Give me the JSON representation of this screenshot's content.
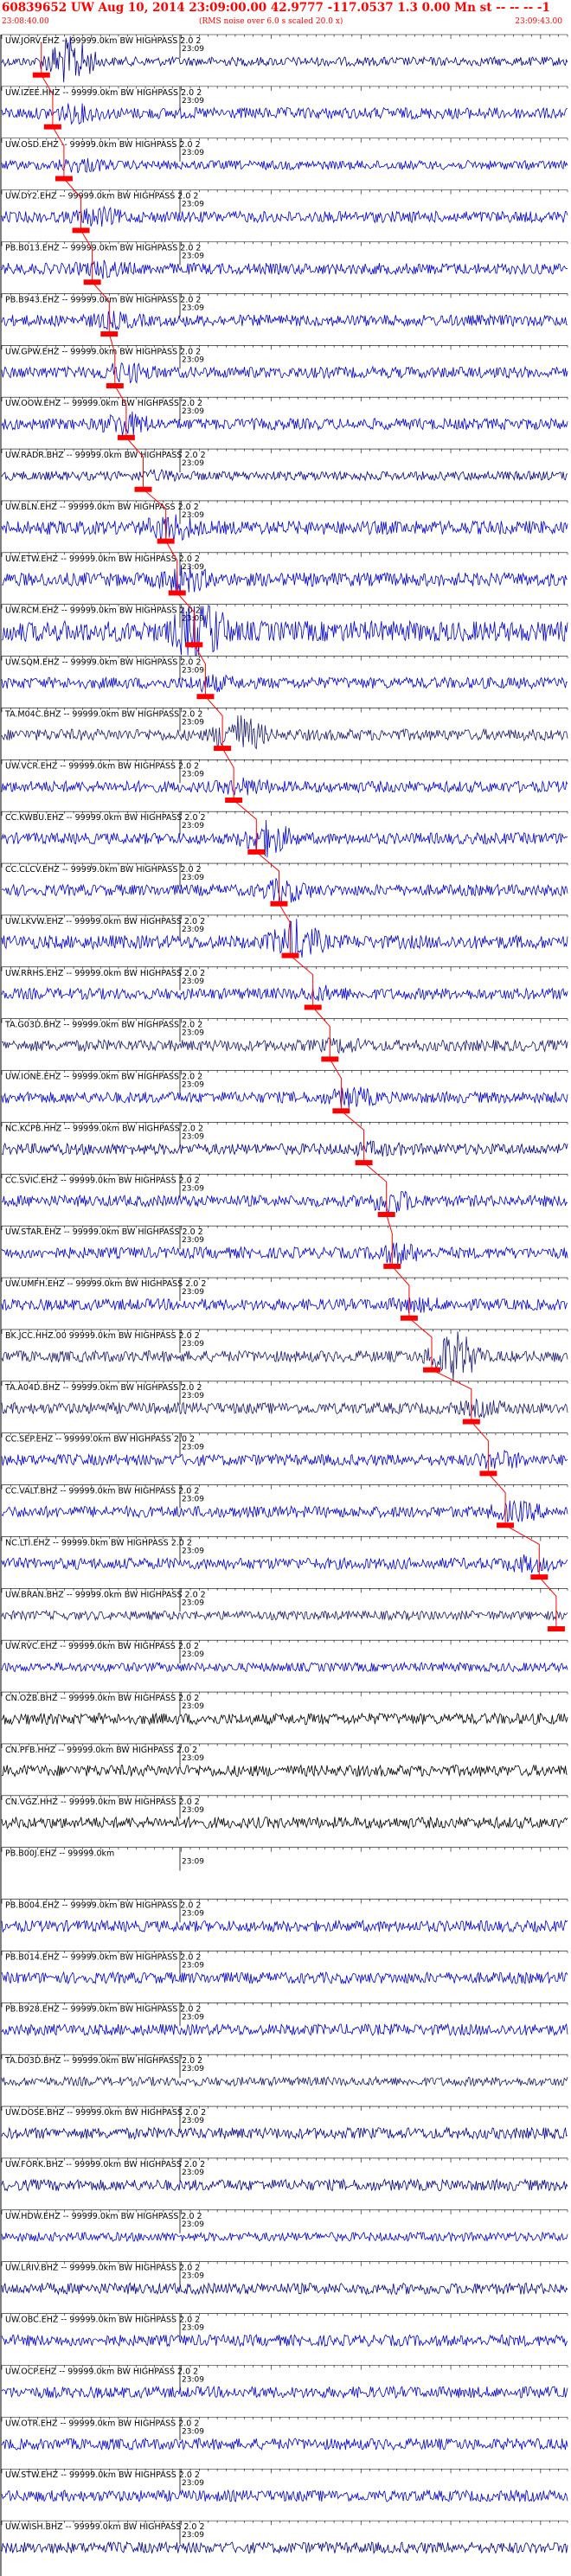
{
  "header": {
    "title": "60839652 UW Aug 10, 2014 23:09:00.00   42.9777 -117.0537  1.3 0.00 Mn st -- -- --  -1",
    "start_time": "23:08:40.00",
    "note": "(RMS noise over 6.0 s scaled 20.0 x)",
    "end_time": "23:09:43.00"
  },
  "chart_data": {
    "type": "seismogram",
    "time_tick_label": "23:09",
    "time_range": [
      "23:08:40.00",
      "23:09:43.00"
    ],
    "traces": [
      {
        "label": "UW.JORV.EHZ -- 99999.0km BW  HIGHPASS  2.0  2",
        "color": "#00008b",
        "amp": 0.4,
        "pick": 0.07,
        "burst": 0.12,
        "burst_amp": 6
      },
      {
        "label": "UW.IZEE.HHZ -- 99999.0km BW  HIGHPASS  2.0  2",
        "color": "#0000cd",
        "amp": 0.5,
        "pick": 0.09,
        "burst": 0.13,
        "burst_amp": 2
      },
      {
        "label": "UW.OSD.EHZ -- 99999.0km BW  HIGHPASS  2.0  2",
        "color": "#0000cd",
        "amp": 0.4,
        "pick": 0.11,
        "burst": 0.14,
        "burst_amp": 2
      },
      {
        "label": "UW.DY2.EHZ -- 99999.0km BW  HIGHPASS  2.0  2",
        "color": "#0000cd",
        "amp": 0.5,
        "pick": 0.14,
        "burst": 0.17,
        "burst_amp": 2
      },
      {
        "label": "PB.B013.EHZ -- 99999.0km BW  HIGHPASS  2.0  2",
        "color": "#0000cd",
        "amp": 0.5,
        "pick": 0.16,
        "burst": 0.18,
        "burst_amp": 1.8
      },
      {
        "label": "PB.B943.EHZ -- 99999.0km BW  HIGHPASS  2.0  2",
        "color": "#0000cd",
        "amp": 0.5,
        "pick": 0.19,
        "burst": 0.2,
        "burst_amp": 1.8
      },
      {
        "label": "UW.GPW.EHZ -- 99999.0km BW  HIGHPASS  2.0  2",
        "color": "#0000cd",
        "amp": 0.5,
        "pick": 0.2,
        "burst": 0.22,
        "burst_amp": 2.2
      },
      {
        "label": "UW.OOW.EHZ -- 99999.0km BW  HIGHPASS  2.0  2",
        "color": "#0000cd",
        "amp": 0.5,
        "pick": 0.22,
        "burst": 0.22,
        "burst_amp": 2.5
      },
      {
        "label": "UW.RADR.BHZ -- 99999.0km BW  HIGHPASS  2.0  2",
        "color": "#00008b",
        "amp": 0.4,
        "pick": 0.25,
        "burst": 0.28,
        "burst_amp": 1.5
      },
      {
        "label": "UW.BLN.EHZ -- 99999.0km BW  HIGHPASS  2.0  2",
        "color": "#0000cd",
        "amp": 0.6,
        "pick": 0.29,
        "burst": 0.3,
        "burst_amp": 2.4
      },
      {
        "label": "UW.ETW.EHZ -- 99999.0km BW  HIGHPASS  2.0  2",
        "color": "#0000cd",
        "amp": 0.6,
        "pick": 0.31,
        "burst": 0.32,
        "burst_amp": 2.4
      },
      {
        "label": "UW.RCM.EHZ -- 99999.0km BW  HIGHPASS  2.0  2",
        "color": "#0000cd",
        "amp": 0.9,
        "pick": 0.34,
        "burst": 0.35,
        "burst_amp": 4
      },
      {
        "label": "UW.SQM.EHZ -- 99999.0km BW  HIGHPASS  2.0  2",
        "color": "#0000cd",
        "amp": 0.5,
        "pick": 0.36,
        "burst": 0.37,
        "burst_amp": 1.8
      },
      {
        "label": "TA.M04C.BHZ -- 99999.0km BW  HIGHPASS  2.0  2",
        "color": "#191970",
        "amp": 0.5,
        "pick": 0.39,
        "burst": 0.42,
        "burst_amp": 4
      },
      {
        "label": "UW.VCR.EHZ -- 99999.0km BW  HIGHPASS  2.0  2",
        "color": "#0000cd",
        "amp": 0.5,
        "pick": 0.41,
        "burst": 0.43,
        "burst_amp": 1.8
      },
      {
        "label": "CC.KWBU.EHZ -- 99999.0km BW  HIGHPASS  2.0  2",
        "color": "#0000cd",
        "amp": 0.5,
        "pick": 0.45,
        "burst": 0.47,
        "burst_amp": 3.5
      },
      {
        "label": "CC.CLCV.EHZ -- 99999.0km BW  HIGHPASS  2.0  2",
        "color": "#0000cd",
        "amp": 0.5,
        "pick": 0.49,
        "burst": 0.5,
        "burst_amp": 2.5
      },
      {
        "label": "UW.LKVW.EHZ -- 99999.0km BW  HIGHPASS  2.0  2",
        "color": "#0000cd",
        "amp": 0.6,
        "pick": 0.51,
        "burst": 0.52,
        "burst_amp": 3.5
      },
      {
        "label": "UW.RRHS.EHZ -- 99999.0km BW  HIGHPASS  2.0  2",
        "color": "#0000cd",
        "amp": 0.5,
        "pick": 0.55,
        "burst": 0.57,
        "burst_amp": 1.6
      },
      {
        "label": "TA.G03D.BHZ -- 99999.0km BW  HIGHPASS  2.0  2",
        "color": "#191970",
        "amp": 0.5,
        "pick": 0.58,
        "burst": 0.6,
        "burst_amp": 1.6
      },
      {
        "label": "UW.IONE.EHZ -- 99999.0km BW  HIGHPASS  2.0  2",
        "color": "#0000cd",
        "amp": 0.5,
        "pick": 0.6,
        "burst": 0.62,
        "burst_amp": 2.2
      },
      {
        "label": "NC.KCPB.HHZ -- 99999.0km BW  HIGHPASS  2.0  2",
        "color": "#00008b",
        "amp": 0.5,
        "pick": 0.64,
        "burst": 0.66,
        "burst_amp": 1.5
      },
      {
        "label": "CC.SVIC.EHZ -- 99999.0km BW  HIGHPASS  2.0  2",
        "color": "#0000cd",
        "amp": 0.5,
        "pick": 0.68,
        "burst": 0.69,
        "burst_amp": 2.5
      },
      {
        "label": "UW.STAR.EHZ -- 99999.0km BW  HIGHPASS  2.0  2",
        "color": "#0000cd",
        "amp": 0.5,
        "pick": 0.69,
        "burst": 0.7,
        "burst_amp": 2.2
      },
      {
        "label": "UW.UMFH.EHZ -- 99999.0km BW  HIGHPASS  2.0  2",
        "color": "#0000cd",
        "amp": 0.5,
        "pick": 0.72,
        "burst": 0.73,
        "burst_amp": 1.6
      },
      {
        "label": "BK.JCC.HHZ.00 99999.0km BW  HIGHPASS  2.0  2",
        "color": "#191970",
        "amp": 0.5,
        "pick": 0.76,
        "burst": 0.8,
        "burst_amp": 5
      },
      {
        "label": "TA.A04D.BHZ -- 99999.0km BW  HIGHPASS  2.0  2",
        "color": "#191970",
        "amp": 0.5,
        "pick": 0.83,
        "burst": 0.85,
        "burst_amp": 1.8
      },
      {
        "label": "CC.SEP.EHZ -- 99999.0km BW  HIGHPASS  2.0  2",
        "color": "#0000cd",
        "amp": 0.5,
        "pick": 0.86,
        "burst": 0.88,
        "burst_amp": 2
      },
      {
        "label": "CC.VALT.BHZ -- 99999.0km BW  HIGHPASS  2.0  2",
        "color": "#0000cd",
        "amp": 0.5,
        "pick": 0.89,
        "burst": 0.91,
        "burst_amp": 2.2
      },
      {
        "label": "NC.LTI.EHZ -- 99999.0km BW  HIGHPASS  2.0  2",
        "color": "#0000cd",
        "amp": 0.5,
        "pick": 0.95,
        "burst": 0.93,
        "burst_amp": 1.8
      },
      {
        "label": "UW.BRAN.BHZ -- 99999.0km BW  HIGHPASS  2.0  2",
        "color": "#191970",
        "amp": 0.4,
        "pick": 0.98,
        "burst": 0,
        "burst_amp": 1
      },
      {
        "label": "UW.RVC.EHZ -- 99999.0km BW  HIGHPASS  2.0  2",
        "color": "#0000cd",
        "amp": 0.4,
        "pick": 0,
        "burst": 0,
        "burst_amp": 1
      },
      {
        "label": "CN.OZB.BHZ -- 99999.0km BW  HIGHPASS  2.0  2",
        "color": "#000000",
        "amp": 0.5,
        "pick": 0,
        "burst": 0,
        "burst_amp": 1
      },
      {
        "label": "CN.PFB.HHZ -- 99999.0km BW  HIGHPASS  2.0  2",
        "color": "#000000",
        "amp": 0.5,
        "pick": 0,
        "burst": 0,
        "burst_amp": 1
      },
      {
        "label": "CN.VGZ.HHZ -- 99999.0km BW  HIGHPASS  2.0  2",
        "color": "#000000",
        "amp": 0.5,
        "pick": 0,
        "burst": 0,
        "burst_amp": 1
      },
      {
        "label": "PB.B00J.EHZ -- 99999.0km",
        "color": "#0000cd",
        "amp": 0,
        "pick": 0,
        "burst": 0,
        "burst_amp": 1
      },
      {
        "label": "PB.B004.EHZ -- 99999.0km BW  HIGHPASS  2.0  2",
        "color": "#0000cd",
        "amp": 0.5,
        "pick": 0,
        "burst": 0,
        "burst_amp": 1
      },
      {
        "label": "PB.B014.EHZ -- 99999.0km BW  HIGHPASS  2.0  2",
        "color": "#0000cd",
        "amp": 0.5,
        "pick": 0,
        "burst": 0,
        "burst_amp": 1
      },
      {
        "label": "PB.B928.EHZ -- 99999.0km BW  HIGHPASS  2.0  2",
        "color": "#0000cd",
        "amp": 0.5,
        "pick": 0,
        "burst": 0,
        "burst_amp": 1
      },
      {
        "label": "TA.D03D.BHZ -- 99999.0km BW  HIGHPASS  2.0  2",
        "color": "#191970",
        "amp": 0.4,
        "pick": 0,
        "burst": 0,
        "burst_amp": 1
      },
      {
        "label": "UW.DOSE.BHZ -- 99999.0km BW  HIGHPASS  2.0  2",
        "color": "#00008b",
        "amp": 0.5,
        "pick": 0,
        "burst": 0,
        "burst_amp": 1
      },
      {
        "label": "UW.FORK.BHZ -- 99999.0km BW  HIGHPASS  2.0  2",
        "color": "#00008b",
        "amp": 0.5,
        "pick": 0,
        "burst": 0,
        "burst_amp": 1
      },
      {
        "label": "UW.HDW.EHZ -- 99999.0km BW  HIGHPASS  2.0  2",
        "color": "#0000cd",
        "amp": 0.4,
        "pick": 0,
        "burst": 0,
        "burst_amp": 1
      },
      {
        "label": "UW.LRIV.BHZ -- 99999.0km BW  HIGHPASS  2.0  2",
        "color": "#00008b",
        "amp": 0.5,
        "pick": 0,
        "burst": 0,
        "burst_amp": 1
      },
      {
        "label": "UW.OBC.EHZ -- 99999.0km BW  HIGHPASS  2.0  2",
        "color": "#0000cd",
        "amp": 0.5,
        "pick": 0,
        "burst": 0,
        "burst_amp": 1
      },
      {
        "label": "UW.OCP.EHZ -- 99999.0km BW  HIGHPASS  2.0  2",
        "color": "#0000cd",
        "amp": 0.5,
        "pick": 0,
        "burst": 0,
        "burst_amp": 1
      },
      {
        "label": "UW.OTR.EHZ -- 99999.0km BW  HIGHPASS  2.0  2",
        "color": "#0000cd",
        "amp": 0.5,
        "pick": 0,
        "burst": 0,
        "burst_amp": 1
      },
      {
        "label": "UW.STW.EHZ -- 99999.0km BW  HIGHPASS  2.0  2",
        "color": "#0000cd",
        "amp": 0.5,
        "pick": 0,
        "burst": 0,
        "burst_amp": 1
      },
      {
        "label": "UW.WISH.BHZ -- 99999.0km BW  HIGHPASS  2.0  2",
        "color": "#00008b",
        "amp": 0.5,
        "pick": 0,
        "burst": 0,
        "burst_amp": 1
      }
    ]
  }
}
